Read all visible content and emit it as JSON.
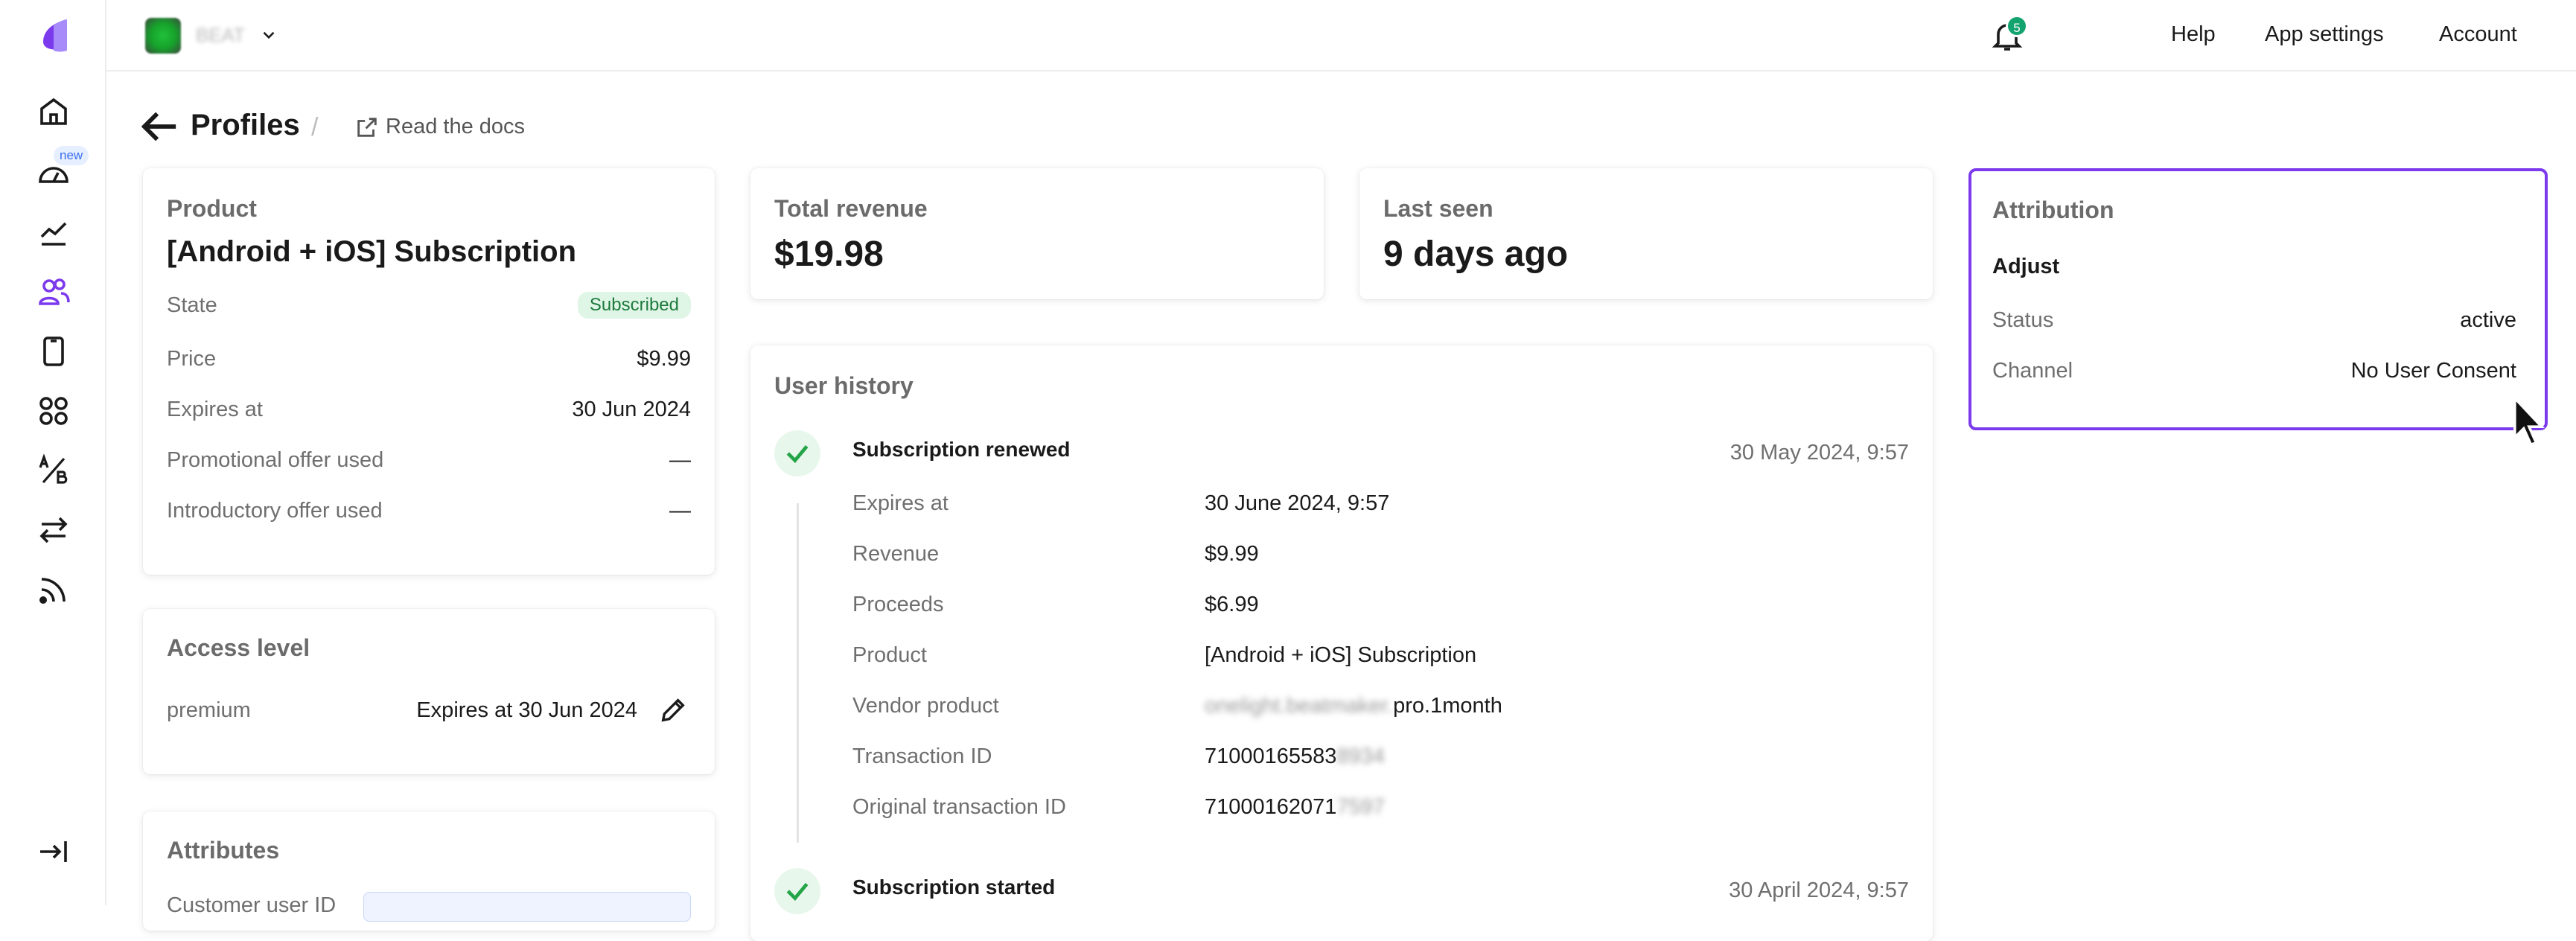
{
  "topbar": {
    "app_name": "BEAT",
    "notifications_count": "5",
    "links": {
      "help": "Help",
      "app_settings": "App settings",
      "account": "Account"
    }
  },
  "sidebar": {
    "new_badge": "new"
  },
  "breadcrumb": {
    "title": "Profiles",
    "separator": "/",
    "docs_link": "Read the docs"
  },
  "product_card": {
    "label": "Product",
    "name": "[Android + iOS] Subscription",
    "rows": [
      {
        "label": "State",
        "value": "Subscribed"
      },
      {
        "label": "Price",
        "value": "$9.99"
      },
      {
        "label": "Expires at",
        "value": "30 Jun 2024"
      },
      {
        "label": "Promotional offer used",
        "value": "—"
      },
      {
        "label": "Introductory offer used",
        "value": "—"
      }
    ]
  },
  "access_card": {
    "label": "Access level",
    "level": "premium",
    "expires": "Expires at 30 Jun 2024"
  },
  "attributes_card": {
    "label": "Attributes",
    "first_row_label": "Customer user ID"
  },
  "revenue_card": {
    "label": "Total revenue",
    "value": "$19.98"
  },
  "last_seen_card": {
    "label": "Last seen",
    "value": "9 days ago"
  },
  "history": {
    "label": "User history",
    "events": [
      {
        "title": "Subscription renewed",
        "date": "30 May 2024, 9:57",
        "rows": [
          {
            "label": "Expires at",
            "value": "30 June 2024, 9:57"
          },
          {
            "label": "Revenue",
            "value": "$9.99"
          },
          {
            "label": "Proceeds",
            "value": "$6.99"
          },
          {
            "label": "Product",
            "value": "[Android + iOS] Subscription"
          },
          {
            "label": "Vendor product",
            "value_hidden": "onelight.beatmaker.",
            "value": "pro.1month"
          },
          {
            "label": "Transaction ID",
            "value": "71000165583",
            "value_hidden": "8934"
          },
          {
            "label": "Original transaction ID",
            "value": "71000162071",
            "value_hidden": "7597"
          }
        ]
      },
      {
        "title": "Subscription started",
        "date": "30 April 2024, 9:57"
      }
    ]
  },
  "attribution_card": {
    "label": "Attribution",
    "source": "Adjust",
    "rows": [
      {
        "label": "Status",
        "value": "active"
      },
      {
        "label": "Channel",
        "value": "No User Consent"
      }
    ]
  },
  "colors": {
    "accent": "#7c3aed",
    "success": "#22a447",
    "badge_bg": "#dff5e6"
  }
}
